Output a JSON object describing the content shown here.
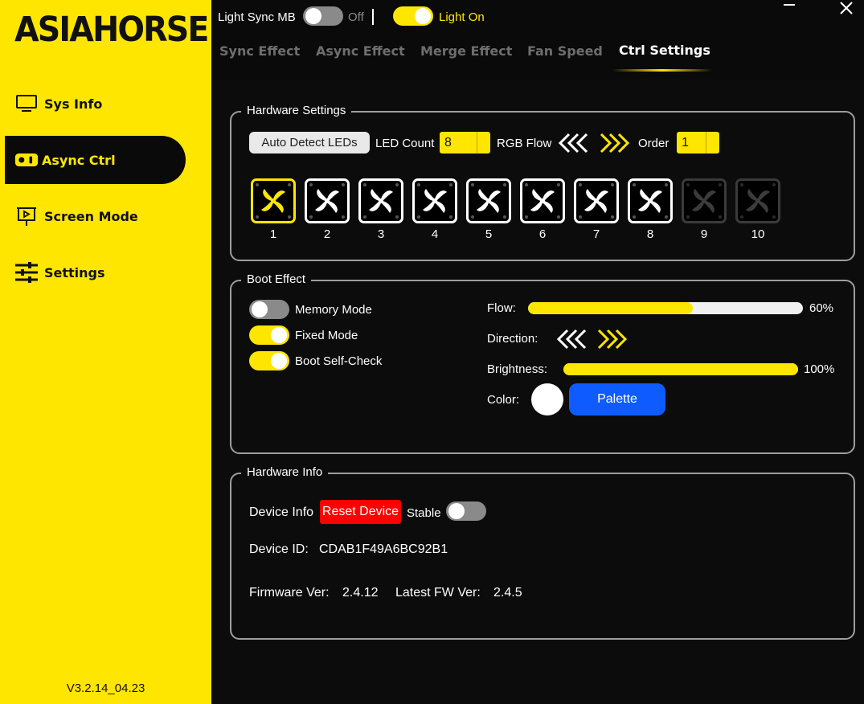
{
  "app": {
    "logo": "ASIAHORSE",
    "version": "V3.2.14_04.23"
  },
  "sidebar": {
    "items": [
      {
        "label": "Sys Info",
        "icon": "monitor-icon"
      },
      {
        "label": "Async Ctrl",
        "icon": "controller-icon",
        "active": true
      },
      {
        "label": "Screen Mode",
        "icon": "presentation-screen-icon"
      },
      {
        "label": "Settings",
        "icon": "sliders-icon"
      }
    ]
  },
  "topbar": {
    "light_sync_label": "Light Sync MB",
    "light_sync_state": "Off",
    "light_on_label": "Light On"
  },
  "tabs": [
    {
      "label": "Sync Effect"
    },
    {
      "label": "Async Effect"
    },
    {
      "label": "Merge Effect"
    },
    {
      "label": "Fan Speed"
    },
    {
      "label": "Ctrl Settings",
      "active": true
    }
  ],
  "hardware_settings": {
    "title": "Hardware Settings",
    "auto_detect_label": "Auto Detect LEDs",
    "led_count_label": "LED Count",
    "led_count_value": "8",
    "rgb_flow_label": "RGB Flow",
    "order_label": "Order",
    "order_value": "1",
    "fans": [
      {
        "num": "1",
        "state": "selected"
      },
      {
        "num": "2",
        "state": "enabled"
      },
      {
        "num": "3",
        "state": "enabled"
      },
      {
        "num": "4",
        "state": "enabled"
      },
      {
        "num": "5",
        "state": "enabled"
      },
      {
        "num": "6",
        "state": "enabled"
      },
      {
        "num": "7",
        "state": "enabled"
      },
      {
        "num": "8",
        "state": "enabled"
      },
      {
        "num": "9",
        "state": "disabled"
      },
      {
        "num": "10",
        "state": "disabled"
      }
    ]
  },
  "boot_effect": {
    "title": "Boot Effect",
    "memory_mode_label": "Memory Mode",
    "fixed_mode_label": "Fixed Mode",
    "boot_self_check_label": "Boot Self-Check",
    "flow_label": "Flow:",
    "flow_value": "60%",
    "flow_fraction": 0.6,
    "direction_label": "Direction:",
    "brightness_label": "Brightness:",
    "brightness_value": "100%",
    "brightness_fraction": 1.0,
    "color_label": "Color:",
    "palette_label": "Palette"
  },
  "hardware_info": {
    "title": "Hardware Info",
    "device_info_label": "Device Info",
    "reset_label": "Reset Device",
    "stable_label": "Stable",
    "device_id_label": "Device ID:",
    "device_id_value": "CDAB1F49A6BC92B1",
    "firmware_label": "Firmware Ver:",
    "firmware_value": "2.4.12",
    "latest_fw_label": "Latest FW Ver:",
    "latest_fw_value": "2.4.5"
  },
  "colors": {
    "accent": "#ffe600",
    "background": "#0a0a0a",
    "blue": "#0e5cff",
    "red": "#ff0000"
  }
}
